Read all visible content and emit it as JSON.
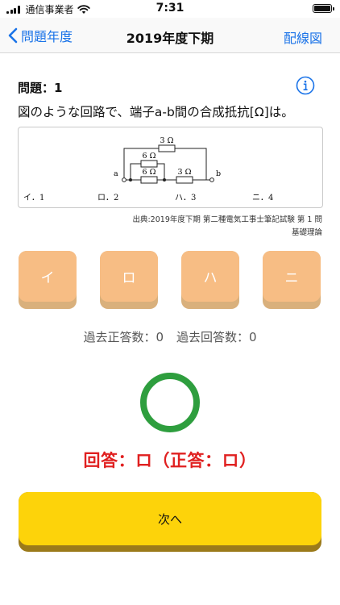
{
  "status": {
    "carrier": "通信事業者",
    "time": "7:31"
  },
  "nav": {
    "back_label": "問題年度",
    "title": "2019年度下期",
    "right_label": "配線図"
  },
  "question": {
    "number_label": "問題：1",
    "text": "図のような回路で、端子a-b間の合成抵抗[Ω]は。",
    "figure": {
      "resistors": [
        "3 Ω",
        "6 Ω",
        "6 Ω",
        "3 Ω"
      ],
      "terminal_a": "a",
      "terminal_b": "b",
      "choices": [
        "イ．1",
        "ロ．2",
        "ハ．3",
        "ニ．4"
      ]
    },
    "source_line1": "出典:2019年度下期 第二種電気工事士筆記試験 第 1 問",
    "source_line2": "基礎理論"
  },
  "answers": [
    "イ",
    "ロ",
    "ハ",
    "ニ"
  ],
  "stats": {
    "correct": "過去正答数：0",
    "answered": "過去回答数：0"
  },
  "result": {
    "answer_line": "回答：ロ（正答：ロ）",
    "circle_color": "#2e9e3e",
    "text_color": "#e02020"
  },
  "next_label": "次へ",
  "colors": {
    "accent": "#1a73e8",
    "answer_button": "#f7bd84",
    "next_button": "#fdd30a"
  }
}
